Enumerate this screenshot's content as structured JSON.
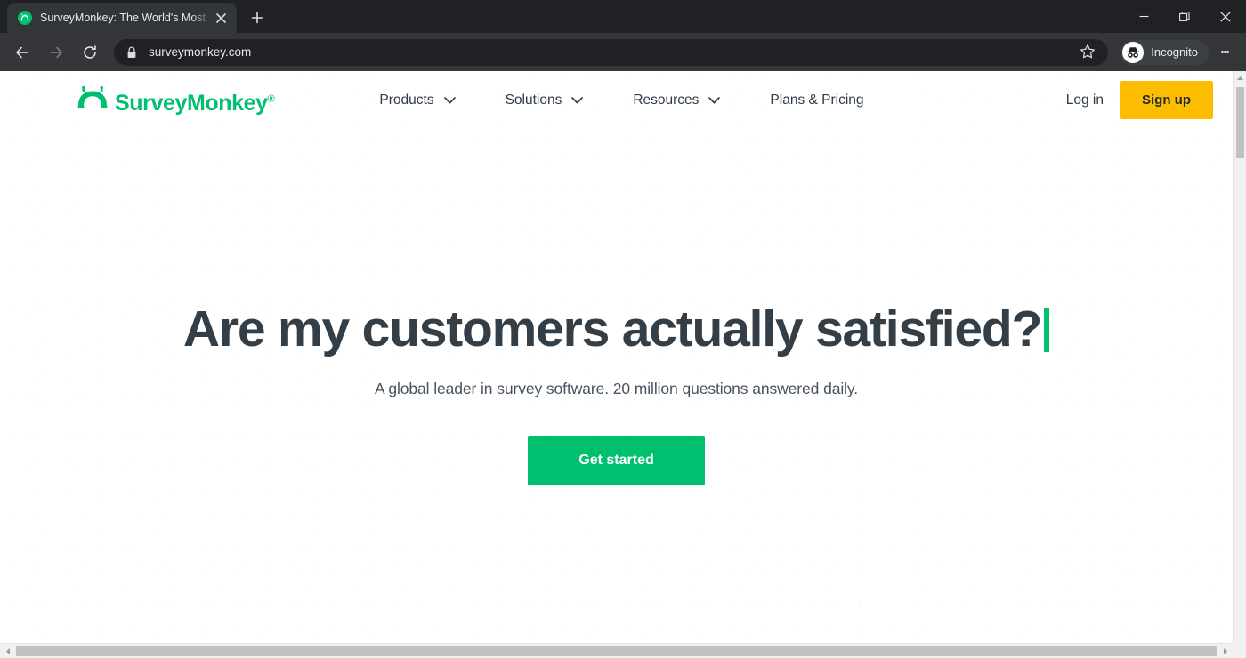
{
  "browser": {
    "tab": {
      "title": "SurveyMonkey: The World's Most",
      "favicon_icon": "surveymonkey-favicon",
      "close_icon": "close-icon"
    },
    "new_tab_icon": "plus-icon",
    "window_controls": {
      "minimize_icon": "minimize-icon",
      "maximize_icon": "maximize-restore-icon",
      "close_icon": "close-icon"
    },
    "toolbar": {
      "back_icon": "arrow-left-icon",
      "forward_icon": "arrow-right-icon",
      "reload_icon": "reload-icon",
      "lock_icon": "lock-icon",
      "url": "surveymonkey.com",
      "bookmark_icon": "star-icon",
      "incognito_label": "Incognito",
      "incognito_icon": "incognito-icon",
      "menu_icon": "kebab-menu-icon"
    },
    "scrollbar": {
      "up_arrow_icon": "triangle-up-icon",
      "left_arrow_icon": "triangle-left-icon",
      "right_arrow_icon": "triangle-right-icon"
    }
  },
  "site": {
    "logo": {
      "wordmark": "SurveyMonkey",
      "registered": "®",
      "icon": "surveymonkey-logo-icon"
    },
    "nav": [
      {
        "label": "Products",
        "has_chevron": true
      },
      {
        "label": "Solutions",
        "has_chevron": true
      },
      {
        "label": "Resources",
        "has_chevron": true
      },
      {
        "label": "Plans & Pricing",
        "has_chevron": false
      }
    ],
    "login_label": "Log in",
    "signup_label": "Sign up",
    "chevron_icon": "chevron-down-icon"
  },
  "hero": {
    "headline": "Are my customers actually satisfied?",
    "subhead": "A global leader in survey software. 20 million questions answered daily.",
    "cta_label": "Get started"
  },
  "colors": {
    "brand_green": "#00bf6f",
    "signup_yellow": "#fcbd00",
    "headline_ink": "#343e47",
    "chrome_dark": "#202124",
    "toolbar_dark": "#35363a"
  }
}
